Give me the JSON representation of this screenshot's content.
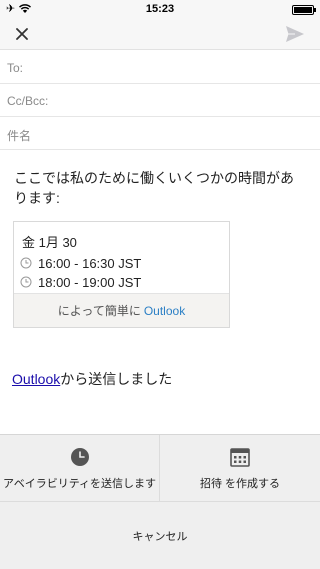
{
  "status_bar": {
    "time": "15:23"
  },
  "compose": {
    "to_label": "To:",
    "cc_label": "Cc/Bcc:",
    "subject_label": "件名"
  },
  "body": {
    "intro": "ここでは私のために働くいくつかの時間があります:",
    "availability": {
      "date": "金 1月 30",
      "slots": [
        "16:00 - 16:30 JST",
        "18:00 - 19:00 JST"
      ],
      "footer_text": "によって簡単に",
      "footer_link": "Outlook"
    },
    "signature_link": "Outlook",
    "signature_text": "から送信しました"
  },
  "action_sheet": {
    "send_availability": "アベイラビリティを送信します",
    "create_invite": "招待 を作成する",
    "cancel": "キャンセル"
  },
  "colors": {
    "link": "#2b7fc5",
    "sheet_bg": "#efefef",
    "icon": "#555555"
  }
}
